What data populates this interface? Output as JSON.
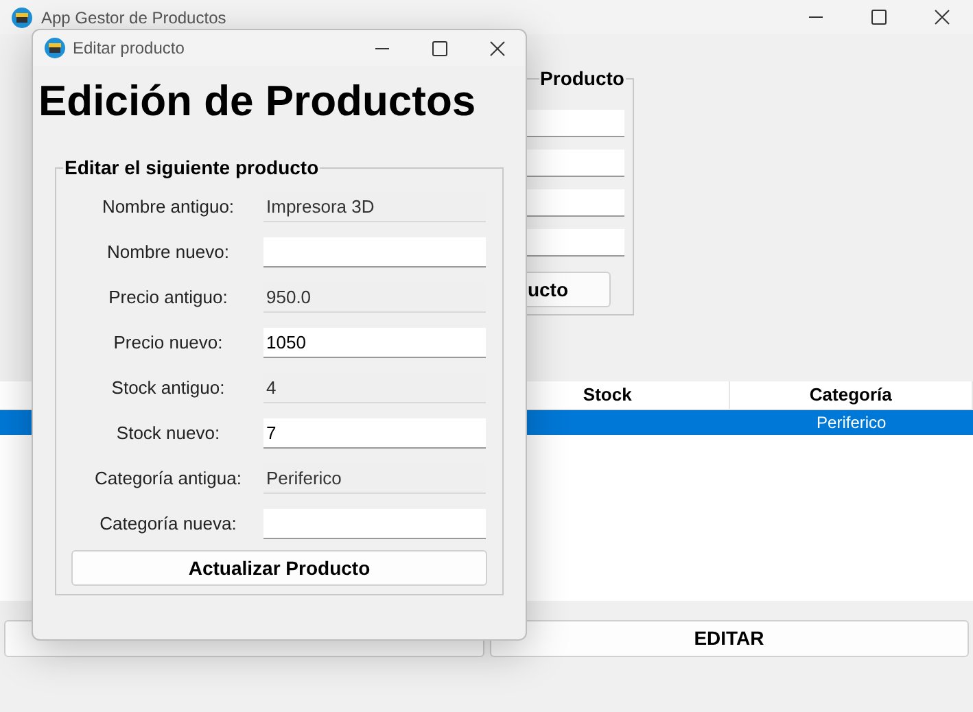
{
  "main_window": {
    "title": "App Gestor de Productos"
  },
  "add_group": {
    "title": "Producto",
    "fields": [
      {
        "disabled": false
      },
      {
        "disabled": false
      },
      {
        "disabled": false
      },
      {
        "disabled": false
      }
    ],
    "button": "ucto"
  },
  "table": {
    "columns": [
      "Stock",
      "Categoría"
    ],
    "rows": [
      {
        "category": "Periferico",
        "selected": true
      }
    ]
  },
  "edit_button": "EDITAR",
  "dialog": {
    "title": "Editar producto",
    "heading": "Edición de Productos",
    "group_title": "Editar el siguiente producto",
    "rows": [
      {
        "label": "Nombre antiguo:",
        "value": "Impresora 3D",
        "disabled": true
      },
      {
        "label": "Nombre nuevo:",
        "value": "",
        "disabled": false
      },
      {
        "label": "Precio antiguo:",
        "value": "950.0",
        "disabled": true
      },
      {
        "label": "Precio nuevo:",
        "value": "1050",
        "disabled": false
      },
      {
        "label": "Stock antiguo:",
        "value": "4",
        "disabled": true
      },
      {
        "label": "Stock nuevo:",
        "value": "7",
        "disabled": false
      },
      {
        "label": "Categoría antigua:",
        "value": "Periferico",
        "disabled": true
      },
      {
        "label": "Categoría nueva:",
        "value": "",
        "disabled": false
      }
    ],
    "button": "Actualizar Producto"
  }
}
